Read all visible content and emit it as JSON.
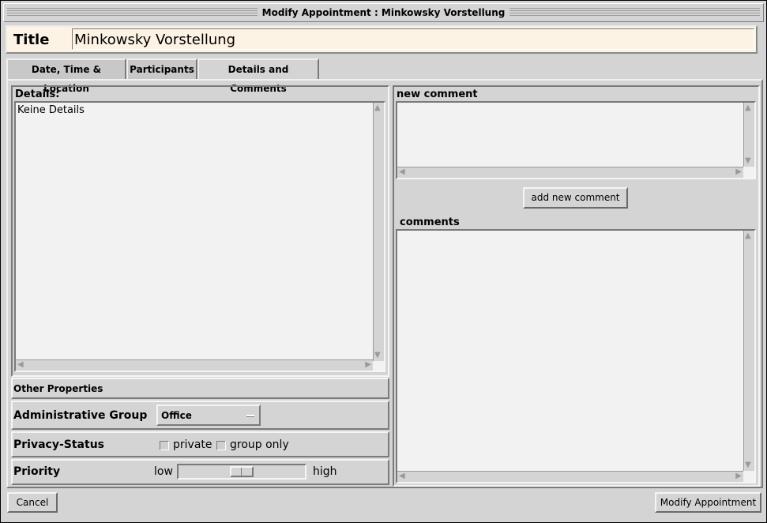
{
  "window": {
    "title": "Modify Appointment : Minkowsky Vorstellung"
  },
  "title_row": {
    "label": "Title",
    "value": "Minkowsky Vorstellung"
  },
  "tabs": [
    {
      "label": "Date, Time & Location",
      "active": false
    },
    {
      "label": "Participants",
      "active": false
    },
    {
      "label": "Details and Comments",
      "active": true
    }
  ],
  "details": {
    "label": "Details:",
    "text": "Keine Details"
  },
  "other_properties": {
    "heading": "Other Properties",
    "admin_group": {
      "label": "Administrative Group",
      "selected": "Office"
    },
    "privacy": {
      "label": "Privacy-Status",
      "private_label": "private",
      "group_only_label": "group only",
      "private_checked": false,
      "group_only_checked": false
    },
    "priority": {
      "label": "Priority",
      "low_label": "low",
      "high_label": "high",
      "level": 0.5
    }
  },
  "new_comment": {
    "label": "new comment",
    "value": "",
    "button": "add new comment"
  },
  "comments": {
    "label": "comments",
    "value": ""
  },
  "footer": {
    "cancel": "Cancel",
    "modify": "Modify Appointment"
  },
  "colors": {
    "background": "#d4d4d4",
    "title_bg": "#fdf3e4",
    "text_area": "#f2f2f2"
  }
}
